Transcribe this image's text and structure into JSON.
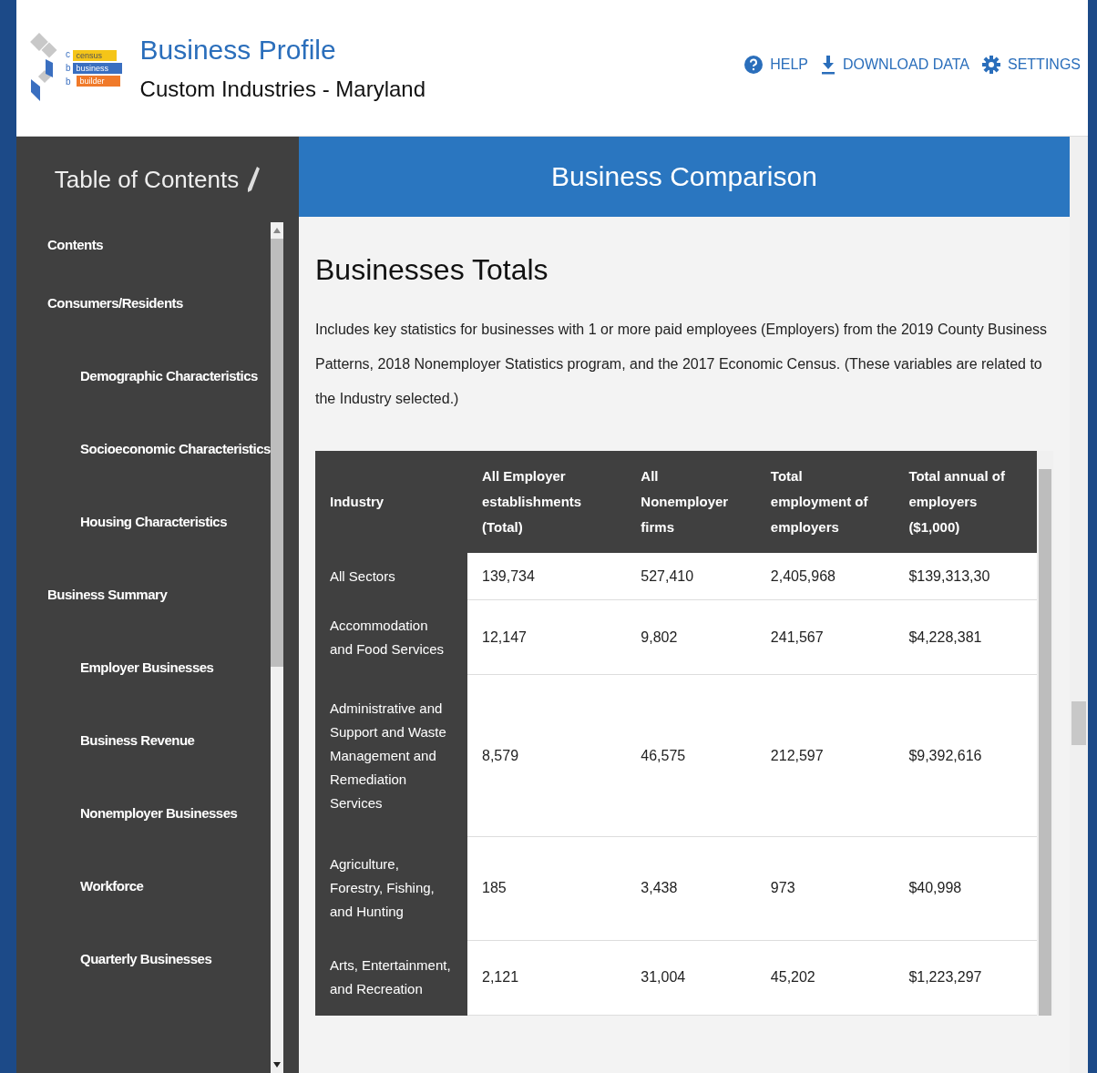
{
  "header": {
    "logo_letters": [
      "c",
      "b",
      "b"
    ],
    "logo_words": [
      "census",
      "business",
      "builder"
    ],
    "title": "Business Profile",
    "subtitle": "Custom Industries - Maryland",
    "actions": [
      {
        "kind": "help",
        "label": "HELP"
      },
      {
        "kind": "download",
        "label": "DOWNLOAD DATA"
      },
      {
        "kind": "settings",
        "label": "SETTINGS"
      }
    ]
  },
  "sidebar": {
    "title": "Table of Contents",
    "items": [
      {
        "label": "Contents"
      },
      {
        "label": "Consumers/Residents",
        "children": [
          {
            "label": "Demographic Characteristics"
          },
          {
            "label": "Socioeconomic Characteristics"
          },
          {
            "label": "Housing Characteristics"
          }
        ]
      },
      {
        "label": "Business Summary",
        "children": [
          {
            "label": "Employer Businesses"
          },
          {
            "label": "Business Revenue"
          },
          {
            "label": "Nonemployer Businesses"
          },
          {
            "label": "Workforce"
          },
          {
            "label": "Quarterly Businesses"
          }
        ]
      }
    ]
  },
  "main": {
    "banner": "Business Comparison",
    "heading": "Businesses Totals",
    "description": "Includes key statistics for businesses with 1 or more paid employees (Employers) from the 2019 County Business Patterns, 2018 Nonemployer Statistics program, and the 2017 Economic Census. (These variables are related to the Industry selected.)",
    "table": {
      "columns": [
        "Industry",
        "All Employer establishments (Total)",
        "All Nonemployer firms",
        "Total employment of employers",
        "Total annual of employers ($1,000)"
      ],
      "rows": [
        [
          "All Sectors",
          "139,734",
          "527,410",
          "2,405,968",
          "$139,313,30"
        ],
        [
          "Accommodation and Food Services",
          "12,147",
          "9,802",
          "241,567",
          "$4,228,381"
        ],
        [
          "Administrative and Support and Waste Management and Remediation Services",
          "8,579",
          "46,575",
          "212,597",
          "$9,392,616"
        ],
        [
          "Agriculture, Forestry, Fishing, and Hunting",
          "185",
          "3,438",
          "973",
          "$40,998"
        ],
        [
          "Arts, Entertainment, and Recreation",
          "2,121",
          "31,004",
          "45,202",
          "$1,223,297"
        ]
      ]
    }
  }
}
